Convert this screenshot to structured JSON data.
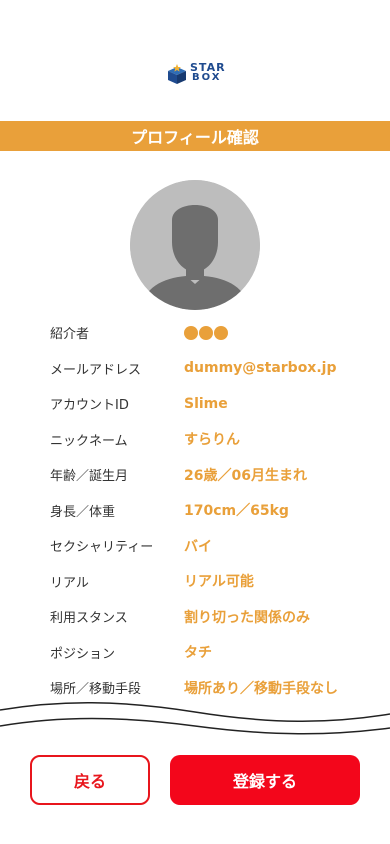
{
  "logo": {
    "line1": "STAR",
    "line2": "BOX"
  },
  "header": {
    "title": "プロフィール確認"
  },
  "profile": [
    {
      "label": "紹介者",
      "value": "",
      "dots": 3
    },
    {
      "label": "メールアドレス",
      "value": "dummy@starbox.jp"
    },
    {
      "label": "アカウントID",
      "value": "Slime"
    },
    {
      "label": "ニックネーム",
      "value": "すらりん"
    },
    {
      "label": "年齢／誕生月",
      "value": "26歳／06月生まれ"
    },
    {
      "label": "身長／体重",
      "value": "170cm／65kg"
    },
    {
      "label": "セクシャリティー",
      "value": "バイ"
    },
    {
      "label": "リアル",
      "value": "リアル可能"
    },
    {
      "label": "利用スタンス",
      "value": "割り切った関係のみ"
    },
    {
      "label": "ポジション",
      "value": "タチ"
    },
    {
      "label": "場所／移動手段",
      "value": "場所あり／移動手段なし"
    }
  ],
  "buttons": {
    "back": "戻る",
    "register": "登録する"
  },
  "colors": {
    "accent": "#e9a03a",
    "primary": "#f3061b",
    "brand": "#1f4b8f"
  }
}
